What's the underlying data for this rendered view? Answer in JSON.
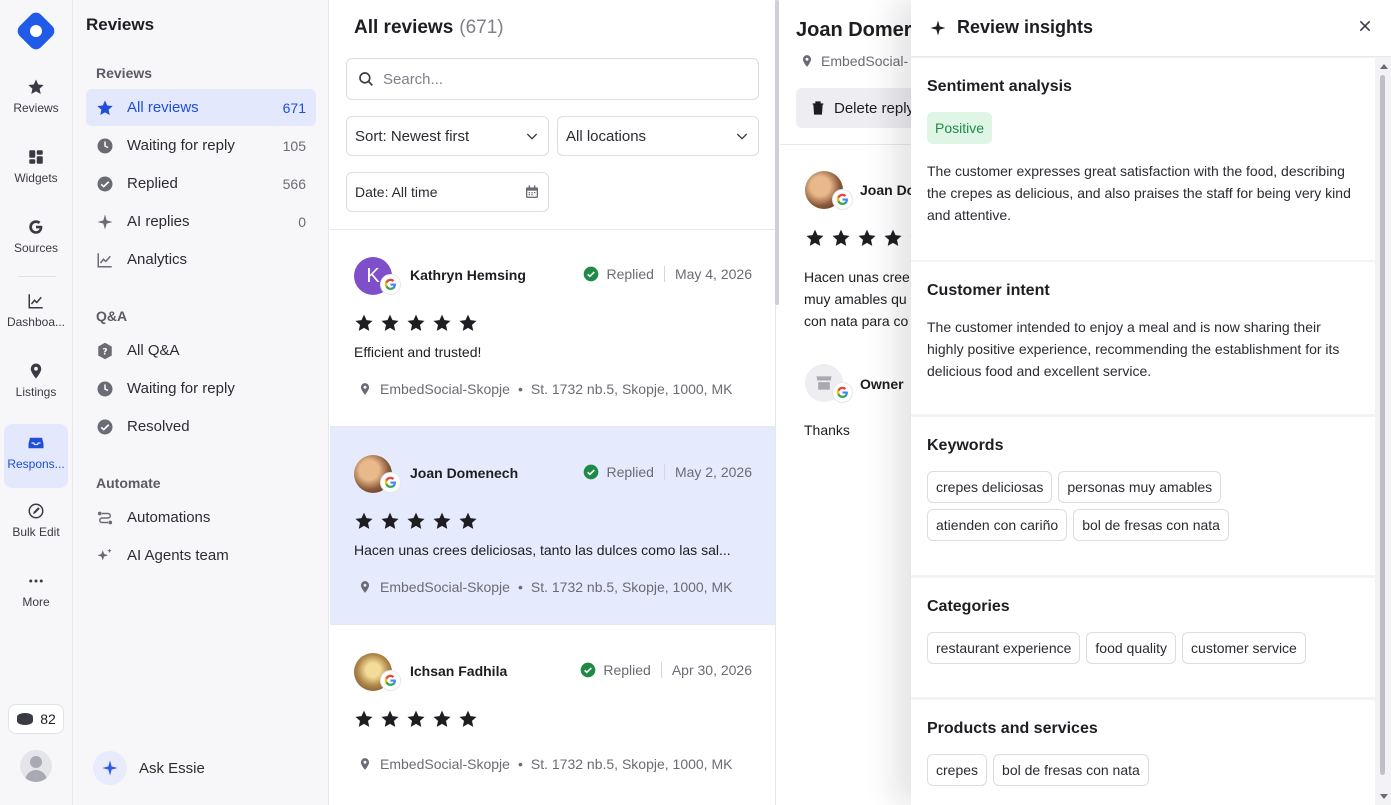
{
  "rail": {
    "items": [
      {
        "label": "Reviews",
        "icon": "star-icon"
      },
      {
        "label": "Widgets",
        "icon": "widgets-icon"
      },
      {
        "label": "Sources",
        "icon": "google-icon"
      },
      {
        "label": "Dashboa...",
        "icon": "chart-line-icon"
      },
      {
        "label": "Listings",
        "icon": "map-pin-icon"
      },
      {
        "label": "Respons...",
        "icon": "inbox-icon"
      },
      {
        "label": "Bulk Edit",
        "icon": "edit-icon"
      },
      {
        "label": "More",
        "icon": "more-icon"
      }
    ],
    "credits": "82"
  },
  "nav": {
    "title": "Reviews",
    "section_reviews": "Reviews",
    "reviews_items": [
      {
        "label": "All reviews",
        "count": "671"
      },
      {
        "label": "Waiting for reply",
        "count": "105"
      },
      {
        "label": "Replied",
        "count": "566"
      },
      {
        "label": "AI replies",
        "count": "0"
      },
      {
        "label": "Analytics",
        "count": ""
      }
    ],
    "section_qa": "Q&A",
    "qa_items": [
      {
        "label": "All Q&A"
      },
      {
        "label": "Waiting for reply"
      },
      {
        "label": "Resolved"
      }
    ],
    "section_automate": "Automate",
    "automate_items": [
      {
        "label": "Automations"
      },
      {
        "label": "AI Agents team"
      }
    ],
    "ask": "Ask Essie"
  },
  "list": {
    "title": "All reviews",
    "count": "(671)",
    "search_placeholder": "Search...",
    "sort": "Sort: Newest first",
    "locations": "All locations",
    "date": "Date: All time",
    "reviews": [
      {
        "name": "Kathryn Hemsing",
        "initial": "K",
        "status": "Replied",
        "date": "May 4, 2026",
        "stars": 5,
        "text": "Efficient and trusted!",
        "location": "EmbedSocial-Skopje",
        "address": "St. 1732 nb.5, Skopje, 1000, MK"
      },
      {
        "name": "Joan Domenech",
        "initial": "",
        "status": "Replied",
        "date": "May 2, 2026",
        "stars": 5,
        "text": "Hacen unas crees deliciosas, tanto las dulces como las sal...",
        "location": "EmbedSocial-Skopje",
        "address": "St. 1732 nb.5, Skopje, 1000, MK"
      },
      {
        "name": "Ichsan Fadhila",
        "initial": "",
        "status": "Replied",
        "date": "Apr 30, 2026",
        "stars": 5,
        "text": "",
        "location": "EmbedSocial-Skopje",
        "address": "St. 1732 nb.5, Skopje, 1000, MK"
      }
    ]
  },
  "detail": {
    "name": "Joan Domer",
    "location": "EmbedSocial-",
    "delete_reply": "Delete reply",
    "reviewer": "Joan Do",
    "text_lines": [
      "Hacen unas cree",
      "muy amables qu",
      "con nata para co"
    ],
    "owner": "Owner",
    "reply": "Thanks"
  },
  "insights": {
    "title": "Review insights",
    "sentiment": {
      "heading": "Sentiment analysis",
      "badge": "Positive",
      "text": "The customer expresses great satisfaction with the food, describing the crepes as delicious, and also praises the staff for being very kind and attentive."
    },
    "intent": {
      "heading": "Customer intent",
      "text": "The customer intended to enjoy a meal and is now sharing their highly positive experience, recommending the establishment for its delicious food and excellent service."
    },
    "keywords": {
      "heading": "Keywords",
      "items": [
        "crepes deliciosas",
        "personas muy amables",
        "atienden con cariño",
        "bol de fresas con nata"
      ]
    },
    "categories": {
      "heading": "Categories",
      "items": [
        "restaurant experience",
        "food quality",
        "customer service"
      ]
    },
    "products": {
      "heading": "Products and services",
      "items": [
        "crepes",
        "bol de fresas con nata"
      ]
    }
  },
  "colors": {
    "accent": "#1f5ae8",
    "active_bg": "#e3e8fd",
    "positive_bg": "#dff5e6",
    "positive_text": "#1f8a45",
    "replied_green": "#1f8a45"
  }
}
